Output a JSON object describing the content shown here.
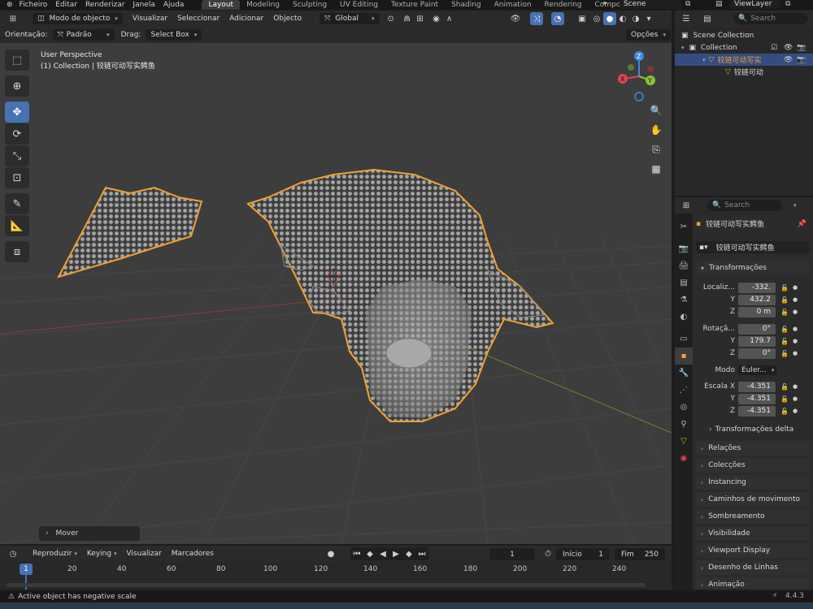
{
  "menu": {
    "items": [
      "Ficheiro",
      "Editar",
      "Renderizar",
      "Janela",
      "Ajuda"
    ],
    "workspaces": [
      "Layout",
      "Modeling",
      "Sculpting",
      "UV Editing",
      "Texture Paint",
      "Shading",
      "Animation",
      "Rendering",
      "Compo"
    ],
    "active_workspace": "Layout",
    "scene": "Scene",
    "view_layer": "ViewLayer"
  },
  "viewport_header": {
    "mode": "Modo de objecto",
    "menus": [
      "Visualizar",
      "Seleccionar",
      "Adicionar",
      "Objecto"
    ],
    "transform_orientation": "Global",
    "orientacao_label": "Orientação:",
    "orientacao_value": "Padrão",
    "drag_label": "Drag:",
    "drag_value": "Select Box",
    "options": "Opções"
  },
  "viewport": {
    "perspective": "User Perspective",
    "collection_info": "(1) Collection | 铰链可动写实鳄鱼",
    "gizmo_axes": {
      "x": "X",
      "y": "Y",
      "z": "Z"
    },
    "last_op": "Mover"
  },
  "timeline": {
    "menus": [
      "Reproduzir",
      "Keying",
      "Visualizar",
      "Marcadores"
    ],
    "current_frame": "1",
    "start_label": "Início",
    "start": "1",
    "end_label": "Fim",
    "end": "250",
    "ticks": [
      "1",
      "20",
      "40",
      "60",
      "80",
      "100",
      "120",
      "140",
      "160",
      "180",
      "200",
      "220",
      "240"
    ]
  },
  "status": {
    "message": "Active object has negative scale",
    "version": "4.4.3"
  },
  "outliner": {
    "search_placeholder": "Search",
    "scene_collection": "Scene Collection",
    "collection": "Collection",
    "object": "铰链可动写实",
    "mesh": "铰链可动"
  },
  "properties": {
    "search_placeholder": "Search",
    "object_name": "铰链可动写实鳄鱼",
    "object_name_field": "铰链可动写实鳄鱼",
    "transform_section": "Transformações",
    "location_label": "Localiz...",
    "location": {
      "x": "-332.",
      "y": "432.2",
      "z": "0 m"
    },
    "rotation_label": "Rotaçã...",
    "rotation": {
      "x": "0°",
      "y": "179.7",
      "z": "0°"
    },
    "mode_label": "Modo",
    "mode_value": "Euler...",
    "scale_label": "Escala X",
    "scale": {
      "x": "-4.351",
      "y": "-4.351",
      "z": "-4.351"
    },
    "delta_section": "Transformações delta",
    "sections": [
      "Relações",
      "Colecções",
      "Instancing",
      "Caminhos de movimento",
      "Sombreamento",
      "Visibilidade",
      "Viewport Display",
      "Desenho de Linhas",
      "Animação"
    ]
  },
  "colors": {
    "accent_blue": "#4772b3",
    "selection_orange": "#f0a030",
    "axis_x": "#e0454f",
    "axis_y": "#8cc33a",
    "axis_z": "#3f87e0",
    "viewport_bg": "#3d3d3d"
  }
}
